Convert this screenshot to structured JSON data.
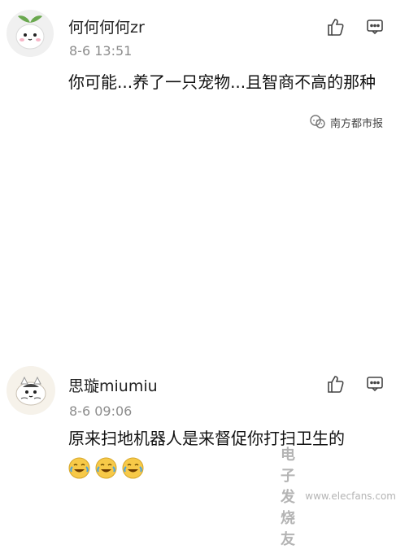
{
  "comments": [
    {
      "username": "何何何何zr",
      "time": "8-6 13:51",
      "text": "你可能...养了一只宠物...且智商不高的那种"
    },
    {
      "username": "思璇miumiu",
      "time": "8-6 09:06",
      "text": "原来扫地机器人是来督促你打扫卫生的"
    }
  ],
  "watermark_top": {
    "text": "南方都市报"
  },
  "watermark_bottom": {
    "brand": "电子发烧友",
    "url": "www.elecfans.com"
  },
  "icons": {
    "like": "thumbs-up-icon",
    "reply": "comment-icon",
    "emoji": "laughing-crying-emoji-icon"
  }
}
